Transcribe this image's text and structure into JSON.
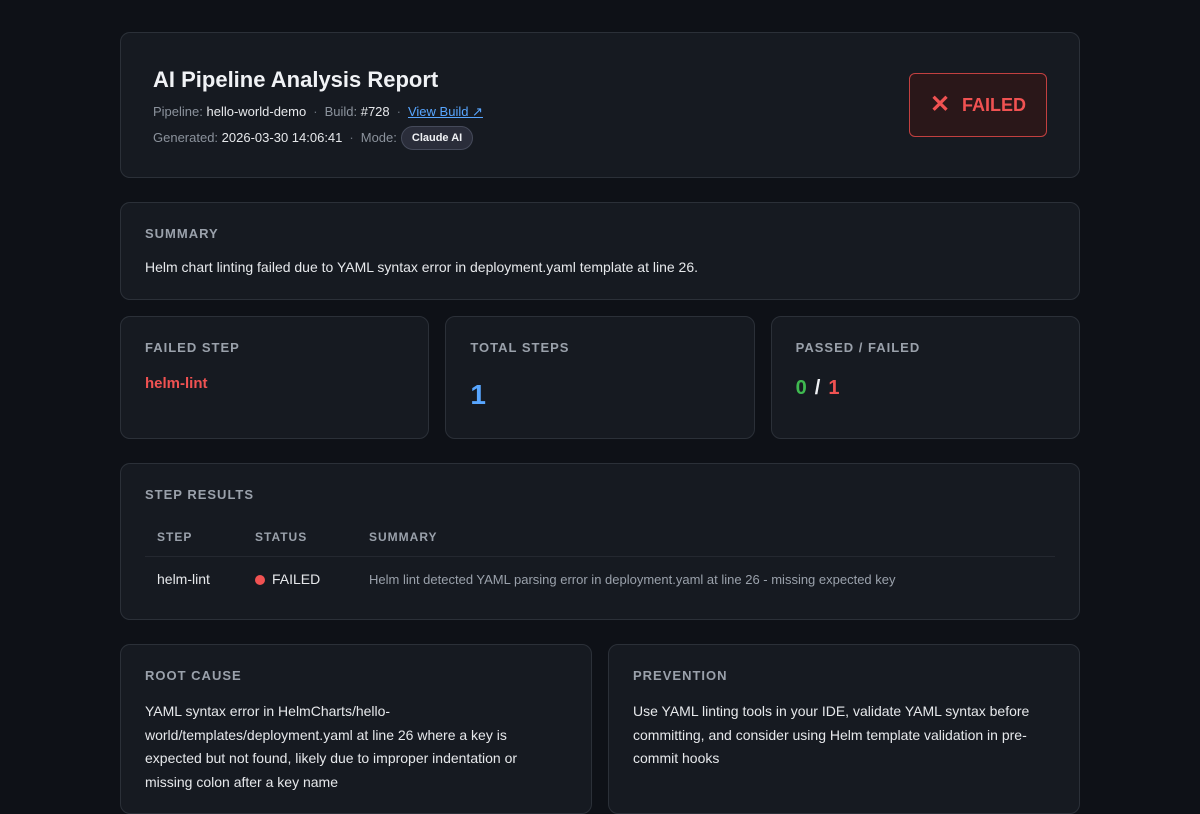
{
  "header": {
    "title": "AI Pipeline Analysis Report",
    "pipeline_label": "Pipeline:",
    "pipeline_value": "hello-world-demo",
    "build_label": "Build:",
    "build_value": "#728",
    "view_build": "View Build ↗",
    "generated_label": "Generated:",
    "generated_value": "2026-03-30 14:06:41",
    "mode_label": "Mode:",
    "mode_value": "Claude AI",
    "sep": "·",
    "status_icon": "✕",
    "status": "FAILED"
  },
  "summary": {
    "label": "SUMMARY",
    "text": "Helm chart linting failed due to YAML syntax error in deployment.yaml template at line 26."
  },
  "stats": {
    "failed_step_label": "FAILED STEP",
    "failed_step_value": "helm-lint",
    "total_steps_label": "TOTAL STEPS",
    "total_steps_value": "1",
    "passed_failed_label": "PASSED / FAILED",
    "passed": "0",
    "slash": "/",
    "failed": "1"
  },
  "step_results": {
    "label": "STEP RESULTS",
    "columns": [
      "STEP",
      "STATUS",
      "SUMMARY"
    ],
    "rows": [
      {
        "step": "helm-lint",
        "status": "FAILED",
        "summary": "Helm lint detected YAML parsing error in deployment.yaml at line 26 - missing expected key"
      }
    ]
  },
  "root_cause": {
    "label": "ROOT CAUSE",
    "text": "YAML syntax error in HelmCharts/hello-world/templates/deployment.yaml at line 26 where a key is expected but not found, likely due to improper indentation or missing colon after a key name"
  },
  "prevention": {
    "label": "PREVENTION",
    "text": "Use YAML linting tools in your IDE, validate YAML syntax before committing, and consider using Helm template validation in pre-commit hooks"
  },
  "colors": {
    "background": "#0e1117",
    "card": "#161a21",
    "failed": "#f05252",
    "passed": "#3fb950",
    "link": "#58a6ff"
  }
}
